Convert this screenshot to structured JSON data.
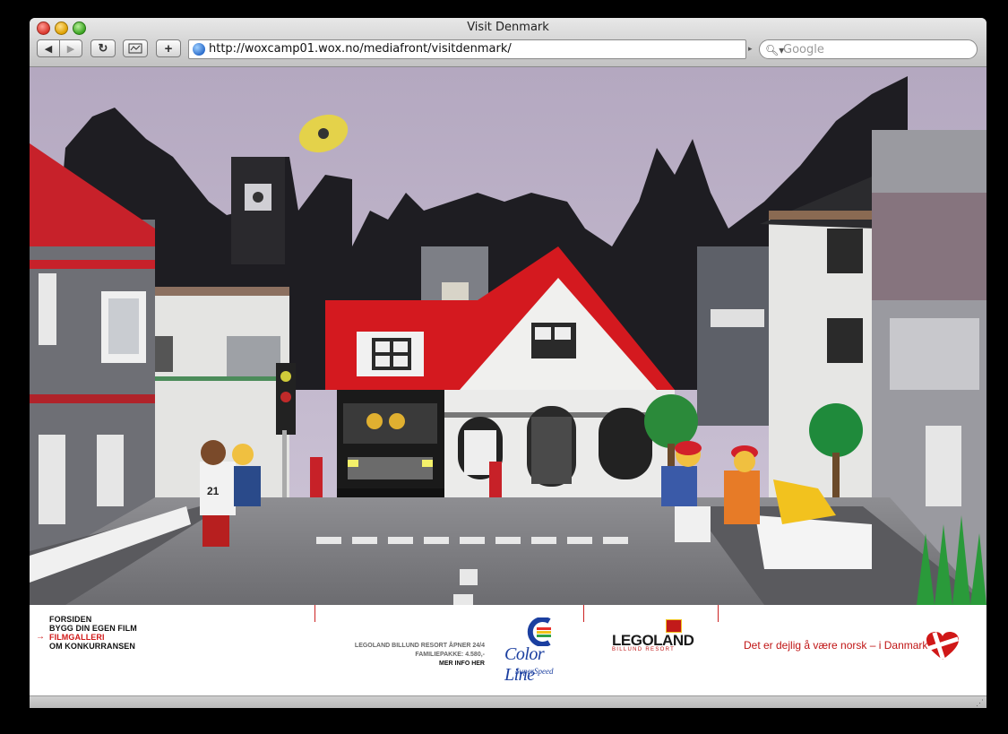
{
  "window": {
    "title": "Visit Denmark"
  },
  "toolbar": {
    "back_icon": "back-arrow-icon",
    "forward_icon": "forward-arrow-icon",
    "reload_icon": "reload-icon",
    "add_icon": "plus-icon"
  },
  "address": {
    "url": "http://woxcamp01.wox.no/mediafront/visitdenmark/"
  },
  "search": {
    "placeholder": "Google"
  },
  "site_nav": {
    "items": [
      {
        "label": "FORSIDEN"
      },
      {
        "label": "BYGG DIN EGEN FILM"
      },
      {
        "label": "FILMGALLERI",
        "active": true
      },
      {
        "label": "OM KONKURRANSEN"
      }
    ]
  },
  "promo": {
    "line1": "LEGOLAND BILLUND RESORT ÅPNER 24/4",
    "line2": "FAMILIEPAKKE: 4.580,-",
    "more": "MER INFO HER"
  },
  "colorline": {
    "name": "Color Line",
    "sub": "SuperSpeed"
  },
  "legoland": {
    "name": "LEGOLAND",
    "sub": "BILLUND RESORT"
  },
  "tagline": "Det er dejlig å være norsk – i Danmark",
  "colors": {
    "accent_red": "#d01818",
    "colorline_blue": "#1b3fa0"
  }
}
